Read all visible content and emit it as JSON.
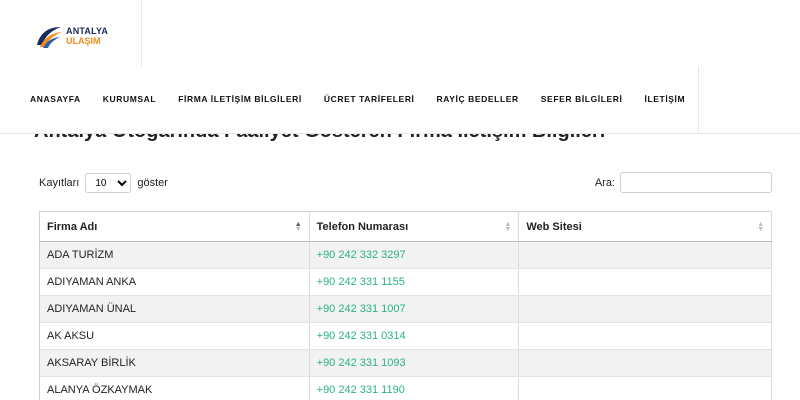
{
  "brand": {
    "top": "ANTALYA",
    "bottom": "ULAŞIM"
  },
  "nav": [
    "ANASAYFA",
    "KURUMSAL",
    "FİRMA İLETİŞİM BİLGİLERİ",
    "ÜCRET TARİFELERİ",
    "RAYİÇ BEDELLER",
    "SEFER BİLGİLERİ",
    "İLETİŞİM"
  ],
  "page_title": "Antalya Otogarında Faaliyet Gösteren Firma İletişim Bilgileri",
  "length": {
    "prefix": "Kayıtları",
    "value": "10",
    "suffix": "göster"
  },
  "search": {
    "label": "Ara:",
    "value": ""
  },
  "table": {
    "headers": [
      "Firma Adı",
      "Telefon Numarası",
      "Web Sitesi"
    ],
    "rows": [
      [
        "ADA TURİZM",
        "+90 242 332 3297",
        ""
      ],
      [
        "ADIYAMAN ANKA",
        "+90 242 331 1155",
        ""
      ],
      [
        "ADIYAMAN ÜNAL",
        "+90 242 331 1007",
        ""
      ],
      [
        "AK AKSU",
        "+90 242 331 0314",
        ""
      ],
      [
        "AKSARAY BİRLİK",
        "+90 242 331 1093",
        ""
      ],
      [
        "ALANYA ÖZKAYMAK",
        "+90 242 331 1190",
        ""
      ]
    ]
  },
  "colors": {
    "phone": "#2bb37f",
    "brand_navy": "#1b2a5c",
    "brand_orange": "#f28c1c"
  }
}
